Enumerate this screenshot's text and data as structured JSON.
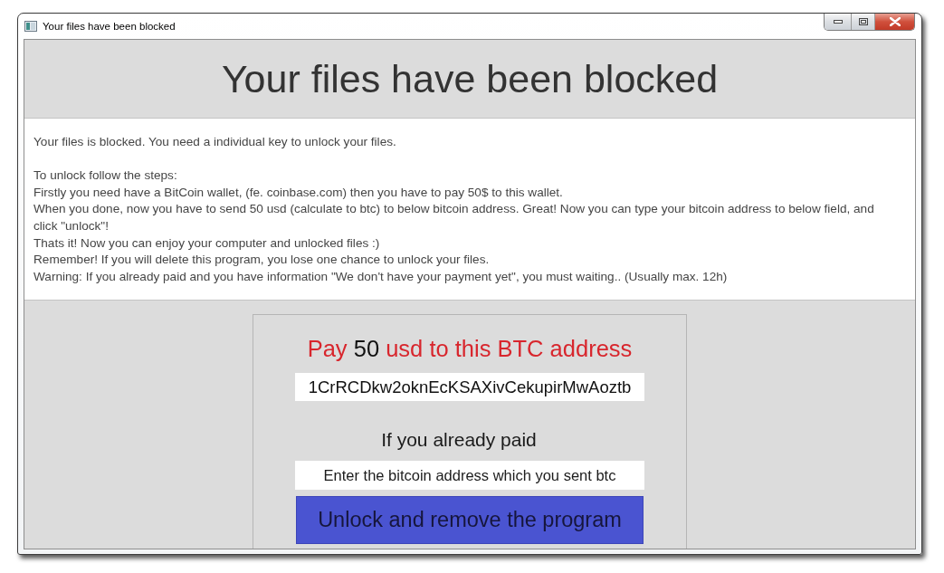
{
  "window": {
    "title": "Your files have been blocked",
    "controls": [
      {
        "kind": "minimize"
      },
      {
        "kind": "maximize"
      },
      {
        "kind": "close"
      }
    ]
  },
  "header": {
    "title": "Your files have been blocked"
  },
  "message": {
    "paragraphs": [
      [
        "Your files is blocked. You need a individual key to unlock your files."
      ],
      [
        "To unlock follow the steps:",
        "Firstly you need have a BitCoin wallet, (fe. coinbase.com) then you have to pay 50$ to this wallet.",
        "When you done, now you have to send 50 usd (calculate to btc) to below bitcoin address. Great! Now you can type your bitcoin address to below field, and click \"unlock\"!",
        "Thats it! Now you can enjoy your computer and unlocked files :)",
        "Remember! If you will delete this program, you lose one chance to unlock your files.",
        "Warning: If you already paid and you have information \"We don't have your payment yet\", you must waiting.. (Usually max. 12h)"
      ]
    ]
  },
  "payment": {
    "heading": [
      {
        "text": "Pay",
        "kind": "accent"
      },
      {
        "text": "50",
        "kind": "amount"
      },
      {
        "text": "usd to this BTC address",
        "kind": "accent"
      }
    ],
    "address": "1CrRCDkw2oknEcKSAXivCekupirMwAoztb",
    "prompt": "If you already paid",
    "input": {
      "placeholder": "Enter the bitcoin address which you sent btc"
    },
    "button": "Unlock and remove the program"
  }
}
